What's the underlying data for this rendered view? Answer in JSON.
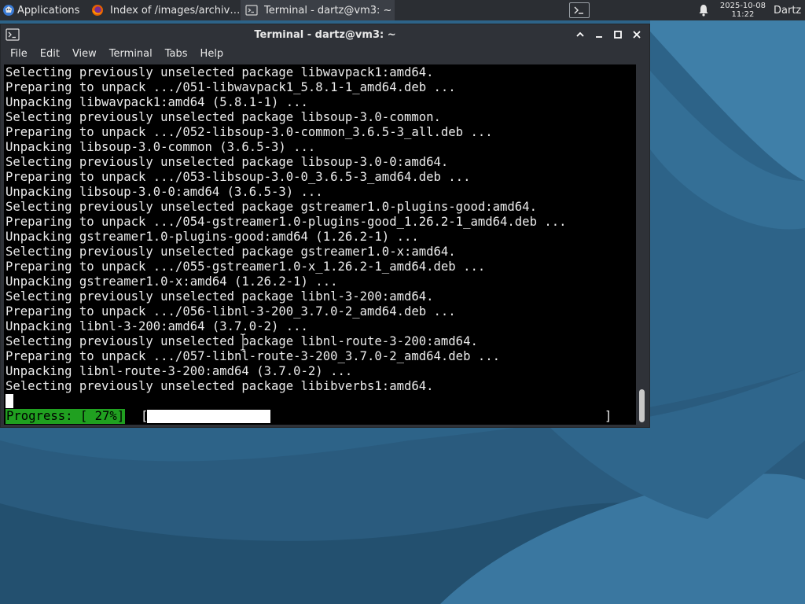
{
  "panel": {
    "applications_label": "Applications",
    "applications_icon": "xfce-logo-icon",
    "tasks": [
      {
        "label": "Index of /images/archiv…",
        "icon": "firefox-icon",
        "active": false
      },
      {
        "label": "Terminal - dartz@vm3: ~",
        "icon": "terminal-icon",
        "active": true
      }
    ],
    "terminal_launcher_icon": "terminal-launcher-icon",
    "notification_icon": "bell-icon",
    "date": "2025-10-08",
    "time": "11:22",
    "user": "Dartz"
  },
  "window": {
    "title": "Terminal - dartz@vm3: ~",
    "icon": "terminal-icon",
    "controls": [
      "chevron-up-icon",
      "minimize-icon",
      "maximize-icon",
      "close-icon"
    ],
    "menu": [
      "File",
      "Edit",
      "View",
      "Terminal",
      "Tabs",
      "Help"
    ]
  },
  "terminal": {
    "lines": [
      "Selecting previously unselected package libwavpack1:amd64.",
      "Preparing to unpack .../051-libwavpack1_5.8.1-1_amd64.deb ...",
      "Unpacking libwavpack1:amd64 (5.8.1-1) ...",
      "Selecting previously unselected package libsoup-3.0-common.",
      "Preparing to unpack .../052-libsoup-3.0-common_3.6.5-3_all.deb ...",
      "Unpacking libsoup-3.0-common (3.6.5-3) ...",
      "Selecting previously unselected package libsoup-3.0-0:amd64.",
      "Preparing to unpack .../053-libsoup-3.0-0_3.6.5-3_amd64.deb ...",
      "Unpacking libsoup-3.0-0:amd64 (3.6.5-3) ...",
      "Selecting previously unselected package gstreamer1.0-plugins-good:amd64.",
      "Preparing to unpack .../054-gstreamer1.0-plugins-good_1.26.2-1_amd64.deb ...",
      "Unpacking gstreamer1.0-plugins-good:amd64 (1.26.2-1) ...",
      "Selecting previously unselected package gstreamer1.0-x:amd64.",
      "Preparing to unpack .../055-gstreamer1.0-x_1.26.2-1_amd64.deb ...",
      "Unpacking gstreamer1.0-x:amd64 (1.26.2-1) ...",
      "Selecting previously unselected package libnl-3-200:amd64.",
      "Preparing to unpack .../056-libnl-3-200_3.7.0-2_amd64.deb ...",
      "Unpacking libnl-3-200:amd64 (3.7.0-2) ...",
      "Selecting previously unselected package libnl-route-3-200:amd64.",
      "Preparing to unpack .../057-libnl-route-3-200_3.7.0-2_amd64.deb ...",
      "Unpacking libnl-route-3-200:amd64 (3.7.0-2) ...",
      "Selecting previously unselected package libibverbs1:amd64."
    ],
    "progress_label": "Progress: [ 27%]",
    "progress_open": "[",
    "progress_close": "]",
    "progress_fraction": 0.27,
    "colors": {
      "background": "#000000",
      "foreground": "#ececec",
      "progress_label_bg": "#20a020",
      "progress_fill": "#ffffff"
    }
  }
}
